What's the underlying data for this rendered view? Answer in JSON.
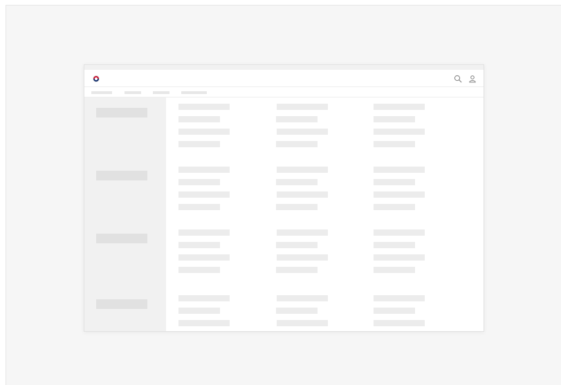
{
  "colors": {
    "backdrop": "#f6f6f6",
    "window_background": "#ffffff",
    "sidebar_background": "#f1f1f1",
    "skeleton_placeholder": "#ececec",
    "sidebar_placeholder": "#e1e1e1",
    "logo_red": "#c8102e",
    "logo_blue": "#0f2b6b"
  },
  "header": {
    "logo_icon": "taegeuk-logo-icon",
    "actions": [
      {
        "icon": "search-icon"
      },
      {
        "icon": "user-icon"
      }
    ]
  },
  "state": "loading-skeleton"
}
